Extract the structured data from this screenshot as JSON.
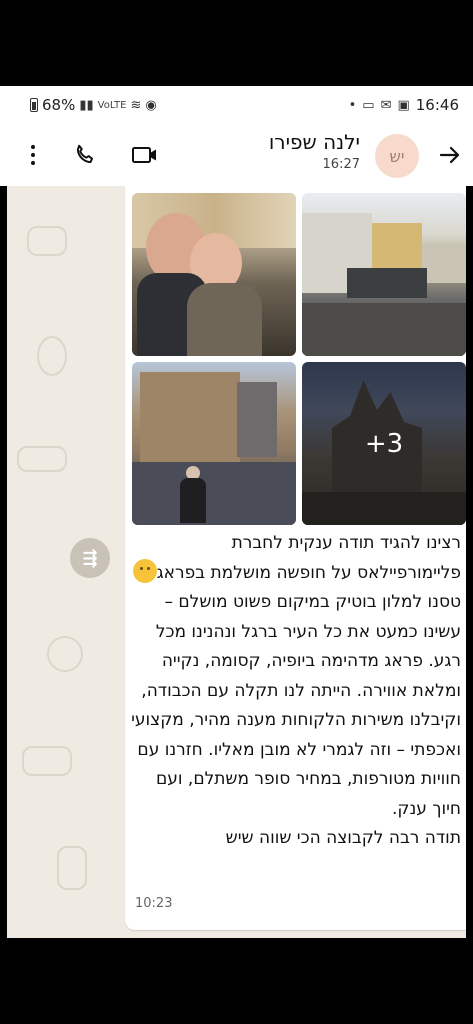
{
  "status_bar": {
    "battery": "68%",
    "network": "VoLTE",
    "time": "16:46"
  },
  "header": {
    "contact_name": "ילנה שפירו",
    "last_seen": "16:27",
    "avatar_initials": "יש",
    "icons": [
      "more-vertical-icon",
      "phone-icon",
      "video-icon",
      "back-arrow-icon"
    ]
  },
  "message": {
    "photo_count_extra": "+3",
    "paragraphs": [
      "רצינו להגיד תודה ענקית לחברת פליימורפיילאס על חופשה מושלמת בפראג",
      "טסנו למלון בוטיק במיקום פשוט מושלם – עשינו כמעט את כל העיר ברגל ונהנינו מכל רגע. פראג מדהימה ביופיה, קסומה, נקייה ומלאת אווירה. הייתה לנו תקלה עם הכבודה, וקיבלנו משירות הלקוחות מענה מהיר, מקצועי ואכפתי – וזה לגמרי לא מובן מאליו. חזרנו עם חוויות מטורפות, במחיר סופר משתלם, ועם חיוך ענק.",
      "תודה רבה לקבוצה הכי שווה שיש"
    ],
    "emoji": "hugging-face-icon",
    "time": "10:23"
  },
  "colors": {
    "chat_background": "#efeae2",
    "bubble": "#ffffff",
    "avatar_bg": "#f8dacd"
  }
}
